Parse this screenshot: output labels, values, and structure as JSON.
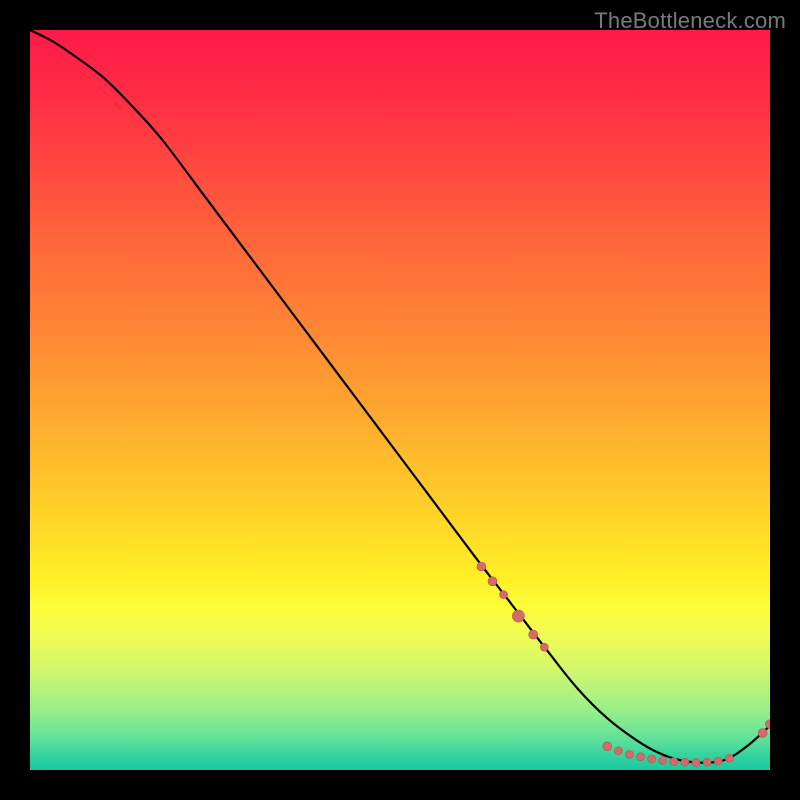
{
  "watermark": "TheBottleneck.com",
  "colors": {
    "background": "#000000",
    "curve": "#000000",
    "dot_fill": "#d46a6a",
    "dot_stroke": "#b45454"
  },
  "chart_data": {
    "type": "line",
    "title": "",
    "xlabel": "",
    "ylabel": "",
    "xlim": [
      0,
      100
    ],
    "ylim": [
      0,
      100
    ],
    "grid": false,
    "series": [
      {
        "name": "curve",
        "x": [
          0,
          3,
          6,
          10,
          14,
          18,
          24,
          30,
          36,
          42,
          48,
          54,
          60,
          65,
          70,
          74,
          78,
          82,
          85,
          88,
          91,
          94,
          97,
          100
        ],
        "y": [
          100,
          98.5,
          96.5,
          93.5,
          89.5,
          85,
          77,
          69,
          61,
          53,
          45,
          37,
          29,
          22.5,
          16,
          11,
          7,
          4,
          2.3,
          1.3,
          1,
          1.4,
          3.3,
          6
        ]
      }
    ],
    "dots": [
      {
        "x": 61.0,
        "y": 27.5,
        "r": 4.5
      },
      {
        "x": 62.5,
        "y": 25.5,
        "r": 4.5
      },
      {
        "x": 64.0,
        "y": 23.7,
        "r": 4.0
      },
      {
        "x": 66.0,
        "y": 20.8,
        "r": 6.0
      },
      {
        "x": 68.0,
        "y": 18.3,
        "r": 4.5
      },
      {
        "x": 69.5,
        "y": 16.6,
        "r": 4.0
      },
      {
        "x": 78.0,
        "y": 3.2,
        "r": 4.5
      },
      {
        "x": 79.5,
        "y": 2.6,
        "r": 4.0
      },
      {
        "x": 81.0,
        "y": 2.1,
        "r": 4.0
      },
      {
        "x": 82.5,
        "y": 1.8,
        "r": 4.0
      },
      {
        "x": 84.0,
        "y": 1.5,
        "r": 4.0
      },
      {
        "x": 85.5,
        "y": 1.3,
        "r": 4.0
      },
      {
        "x": 87.0,
        "y": 1.15,
        "r": 4.0
      },
      {
        "x": 88.5,
        "y": 1.05,
        "r": 4.0
      },
      {
        "x": 90.0,
        "y": 1.0,
        "r": 4.0
      },
      {
        "x": 91.5,
        "y": 1.05,
        "r": 4.0
      },
      {
        "x": 93.0,
        "y": 1.2,
        "r": 4.0
      },
      {
        "x": 94.5,
        "y": 1.6,
        "r": 4.0
      },
      {
        "x": 99.0,
        "y": 5.0,
        "r": 4.5
      },
      {
        "x": 100.0,
        "y": 6.2,
        "r": 4.5
      }
    ]
  }
}
